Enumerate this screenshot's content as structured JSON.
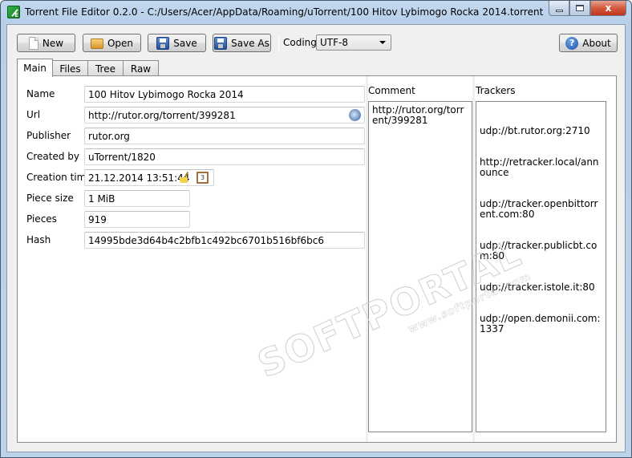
{
  "window": {
    "title": "Torrent File Editor 0.2.0 - C:/Users/Acer/AppData/Roaming/uTorrent/100 Hitov Lybimogo Rocka 2014.torrent",
    "controls": {
      "minimize": "minimize",
      "maximize": "maximize",
      "close": "x"
    }
  },
  "toolbar": {
    "new_label": "New",
    "open_label": "Open",
    "save_label": "Save",
    "save_as_label": "Save As",
    "coding_label": "Coding",
    "coding_value": "UTF-8",
    "about_label": "About",
    "help_glyph": "?"
  },
  "tabs": [
    {
      "label": "Main",
      "active": true
    },
    {
      "label": "Files",
      "active": false
    },
    {
      "label": "Tree",
      "active": false
    },
    {
      "label": "Raw",
      "active": false
    }
  ],
  "main": {
    "fields": {
      "name": {
        "label": "Name",
        "value": "100 Hitov Lybimogo Rocka 2014"
      },
      "url": {
        "label": "Url",
        "value": "http://rutor.org/torrent/399281"
      },
      "publisher": {
        "label": "Publisher",
        "value": "rutor.org"
      },
      "created_by": {
        "label": "Created by",
        "value": "uTorrent/1820"
      },
      "creation_time": {
        "label": "Creation time",
        "value": "21.12.2014 13:51:44"
      },
      "piece_size": {
        "label": "Piece size",
        "value": "1 MiB"
      },
      "pieces": {
        "label": "Pieces",
        "value": "919"
      },
      "hash": {
        "label": "Hash",
        "value": "14995bde3d64b4c2bfb1c492bc6701b516bf6bc6"
      }
    },
    "calendar_glyph": "3",
    "comment": {
      "label": "Comment",
      "value": "http://rutor.org/torrent/399281"
    },
    "trackers": {
      "label": "Trackers",
      "items": [
        "udp://bt.rutor.org:2710",
        "http://retracker.local/announce",
        "udp://tracker.openbittorrent.com:80",
        "udp://tracker.publicbt.com:80",
        "udp://tracker.istole.it:80",
        "udp://open.demonii.com:1337"
      ]
    }
  },
  "watermark": {
    "text": "SOFTPORTAL",
    "url": "www.softportal.com"
  }
}
